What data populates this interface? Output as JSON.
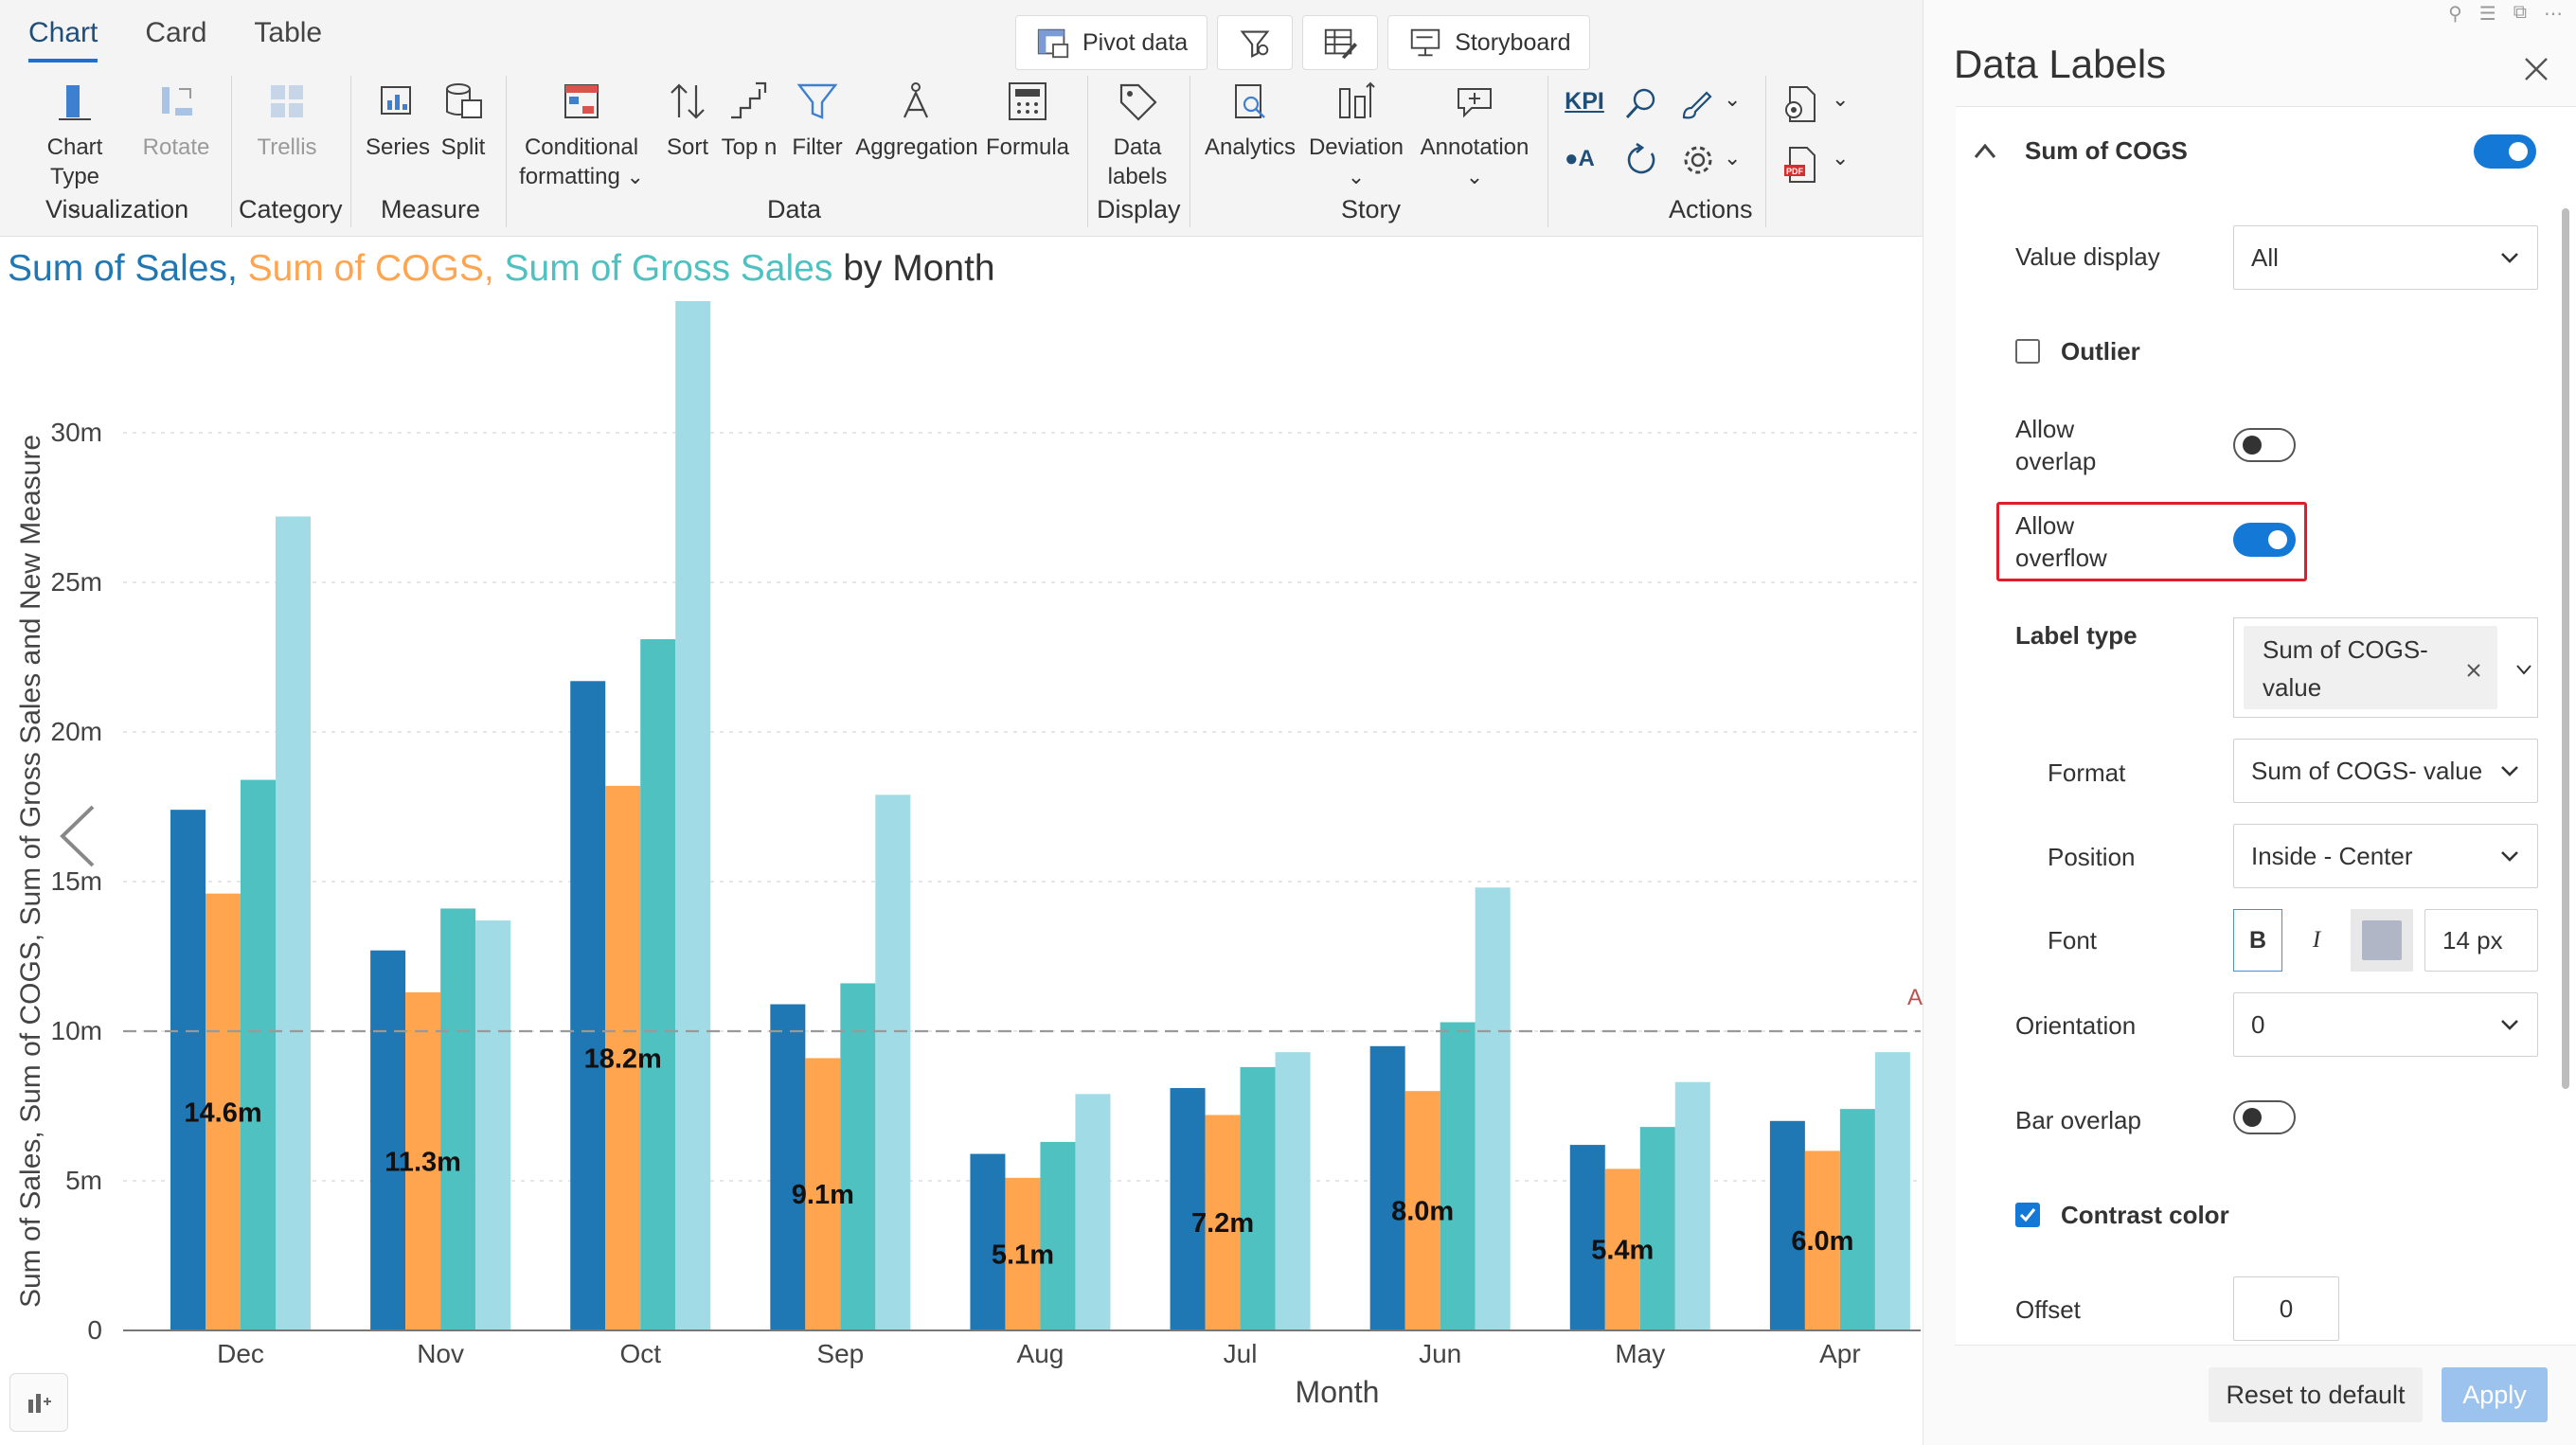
{
  "tabs": [
    {
      "label": "Chart"
    },
    {
      "label": "Card"
    },
    {
      "label": "Table"
    }
  ],
  "toolbar_top": {
    "pivot": "Pivot data",
    "storyboard": "Storyboard"
  },
  "ribbon": {
    "chart_type": "Chart Type",
    "rotate": "Rotate",
    "trellis": "Trellis",
    "series": "Series",
    "split": "Split",
    "cond1": "Conditional",
    "cond2": "formatting",
    "sort": "Sort",
    "topn": "Top n",
    "filter": "Filter",
    "aggregation": "Aggregation",
    "formula": "Formula",
    "labels1": "Data",
    "labels2": "labels",
    "analytics": "Analytics",
    "deviation": "Deviation",
    "annotation": "Annotation",
    "kpi": "KPI",
    "oa": "A",
    "groups": {
      "visualization": "Visualization",
      "category": "Category",
      "measure": "Measure",
      "data": "Data",
      "display": "Display",
      "story": "Story",
      "actions": "Actions"
    }
  },
  "chart_title": {
    "p1": "Sum of  Sales,",
    "p2": "Sum of COGS,",
    "p3": "Sum of Gross Sales",
    "p4": "by  Month"
  },
  "chart_data": {
    "type": "bar",
    "xlabel": "Month",
    "ylabel": "Sum of Sales, Sum of COGS, Sum of Gross Sales and New Measure",
    "categories": [
      "Dec",
      "Nov",
      "Oct",
      "Sep",
      "Aug",
      "Jul",
      "Jun",
      "May",
      "Apr"
    ],
    "ylim": [
      0,
      34
    ],
    "yticks": [
      "0",
      "5m",
      "10m",
      "15m",
      "20m",
      "25m",
      "30m"
    ],
    "ytick_values": [
      0,
      5,
      10,
      15,
      20,
      25,
      30
    ],
    "series": [
      {
        "values": [
          17.4,
          12.7,
          21.7,
          10.9,
          5.9,
          8.1,
          9.5,
          6.2,
          7.0
        ],
        "color": "#1f77b4"
      },
      {
        "values": [
          14.6,
          11.3,
          18.2,
          9.1,
          5.1,
          7.2,
          8.0,
          5.4,
          6.0
        ],
        "color": "#ffa54f"
      },
      {
        "values": [
          18.4,
          14.1,
          23.1,
          11.6,
          6.3,
          8.8,
          10.3,
          6.8,
          7.4
        ],
        "color": "#4fc1c1"
      },
      {
        "values": [
          27.2,
          13.7,
          34.4,
          17.9,
          7.9,
          9.3,
          14.8,
          8.3,
          9.3
        ],
        "color": "#a0dbe6"
      }
    ],
    "data_labels": [
      "14.6m",
      "11.3m",
      "18.2m",
      "9.1m",
      "5.1m",
      "7.2m",
      "8.0m",
      "5.4m",
      "6.0m"
    ],
    "reference_line": 10,
    "ref_label": "A",
    "grid": true
  },
  "panel": {
    "title": "Data Labels",
    "section": "Sum of COGS",
    "value_display_label": "Value display",
    "value_display": "All",
    "outlier": "Outlier",
    "allow_overlap_1": "Allow",
    "allow_overlap_2": "overlap",
    "allow_overflow_1": "Allow",
    "allow_overflow_2": "overflow",
    "label_type": "Label type",
    "label_chip_1": "Sum of COGS-",
    "label_chip_2": "value",
    "format_label": "Format",
    "format_value": "Sum of COGS- value",
    "position_label": "Position",
    "position_value": "Inside - Center",
    "font_label": "Font",
    "bold": "B",
    "italic": "I",
    "font_size": "14 px",
    "orientation_label": "Orientation",
    "orientation_value": "0",
    "bar_overlap": "Bar overlap",
    "contrast": "Contrast color",
    "offset_label": "Offset",
    "offset_value": "0",
    "reset": "Reset to default",
    "apply": "Apply"
  }
}
